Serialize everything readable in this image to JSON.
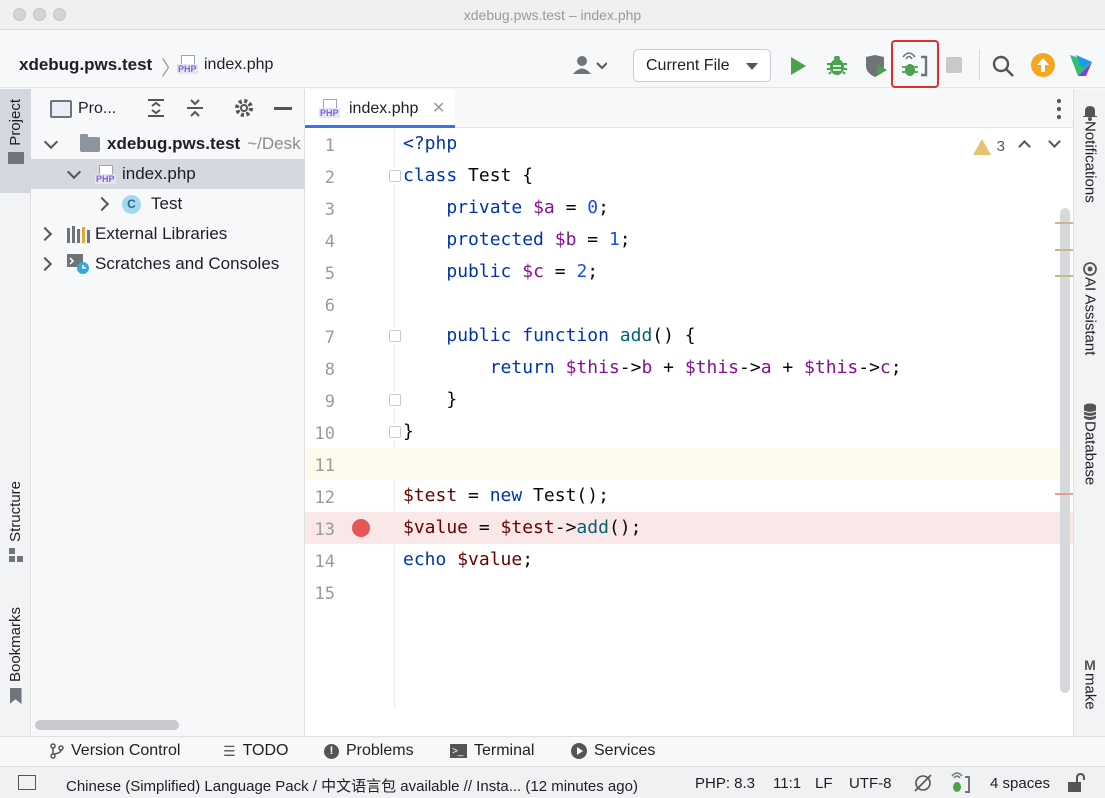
{
  "window": {
    "title": "xdebug.pws.test – index.php"
  },
  "toolbar": {
    "project_name": "xdebug.pws.test",
    "file_name": "index.php",
    "run_config": "Current File"
  },
  "left_strip": {
    "project": "Project",
    "structure": "Structure",
    "bookmarks": "Bookmarks"
  },
  "project_panel": {
    "title": "Pro...",
    "tree": [
      {
        "label": "xdebug.pws.test",
        "suffix": "~/Desk",
        "level": 0,
        "expanded": true
      },
      {
        "label": "index.php",
        "level": 1,
        "expanded": true,
        "selected": true
      },
      {
        "label": "Test",
        "level": 2,
        "expanded": false
      },
      {
        "label": "External Libraries",
        "level": 0,
        "expanded": false
      },
      {
        "label": "Scratches and Consoles",
        "level": 0,
        "expanded": false
      }
    ]
  },
  "editor": {
    "tab_label": "index.php",
    "inspection_count": "3",
    "line_numbers": [
      "1",
      "2",
      "3",
      "4",
      "5",
      "6",
      "7",
      "8",
      "9",
      "10",
      "11",
      "12",
      "13",
      "14",
      "15"
    ],
    "current_line": 11,
    "breakpoint_line": 13
  },
  "code": {
    "l1": "<?php",
    "l2_kw": "class",
    "l2_rest": " Test {",
    "l3_kw": "private",
    "l3_var": "$a",
    "l3_eq": " = ",
    "l3_num": "0",
    "l3_end": ";",
    "l4_kw": "protected",
    "l4_var": "$b",
    "l4_eq": " = ",
    "l4_num": "1",
    "l4_end": ";",
    "l5_kw": "public",
    "l5_var": "$c",
    "l5_eq": " = ",
    "l5_num": "2",
    "l5_end": ";",
    "l7_kw1": "public",
    "l7_kw2": "function",
    "l7_fn": "add",
    "l7_end": "() {",
    "l8_kw": "return",
    "l8_this1": "$this",
    "l8_arrow1": "->",
    "l8_p1": "b",
    "l8_plus1": " + ",
    "l8_this2": "$this",
    "l8_arrow2": "->",
    "l8_p2": "a",
    "l8_plus2": " + ",
    "l8_this3": "$this",
    "l8_arrow3": "->",
    "l8_p3": "c",
    "l8_semi": ";",
    "l9": "}",
    "l10": "}",
    "l12_var": "$test",
    "l12_eq": " = ",
    "l12_kw": "new",
    "l12_rest": " Test();",
    "l13_var1": "$value",
    "l13_eq": " = ",
    "l13_var2": "$test",
    "l13_arrow": "->",
    "l13_fn": "add",
    "l13_end": "();",
    "l14_kw": "echo",
    "l14_var": "$value",
    "l14_end": ";"
  },
  "right_strip": {
    "notifications": "Notifications",
    "ai": "AI Assistant",
    "database": "Database",
    "make": "make"
  },
  "bottom_tools": [
    "Version Control",
    "TODO",
    "Problems",
    "Terminal",
    "Services"
  ],
  "status_bar": {
    "message": "Chinese (Simplified) Language Pack / 中文语言包 available // Insta... (12 minutes ago)",
    "php": "PHP: 8.3",
    "position": "11:1",
    "line_sep": "LF",
    "encoding": "UTF-8",
    "indent": "4 spaces"
  },
  "colors": {
    "accent": "#3574f0",
    "breakpoint": "#e55757",
    "highlight_box": "#e0302a",
    "run_green": "#4aa24c"
  },
  "icons": [
    "user-icon",
    "run-icon",
    "debug-icon",
    "coverage-icon",
    "listen-debug-icon",
    "stop-icon",
    "search-icon",
    "update-icon",
    "jetbrains-logo-icon"
  ]
}
